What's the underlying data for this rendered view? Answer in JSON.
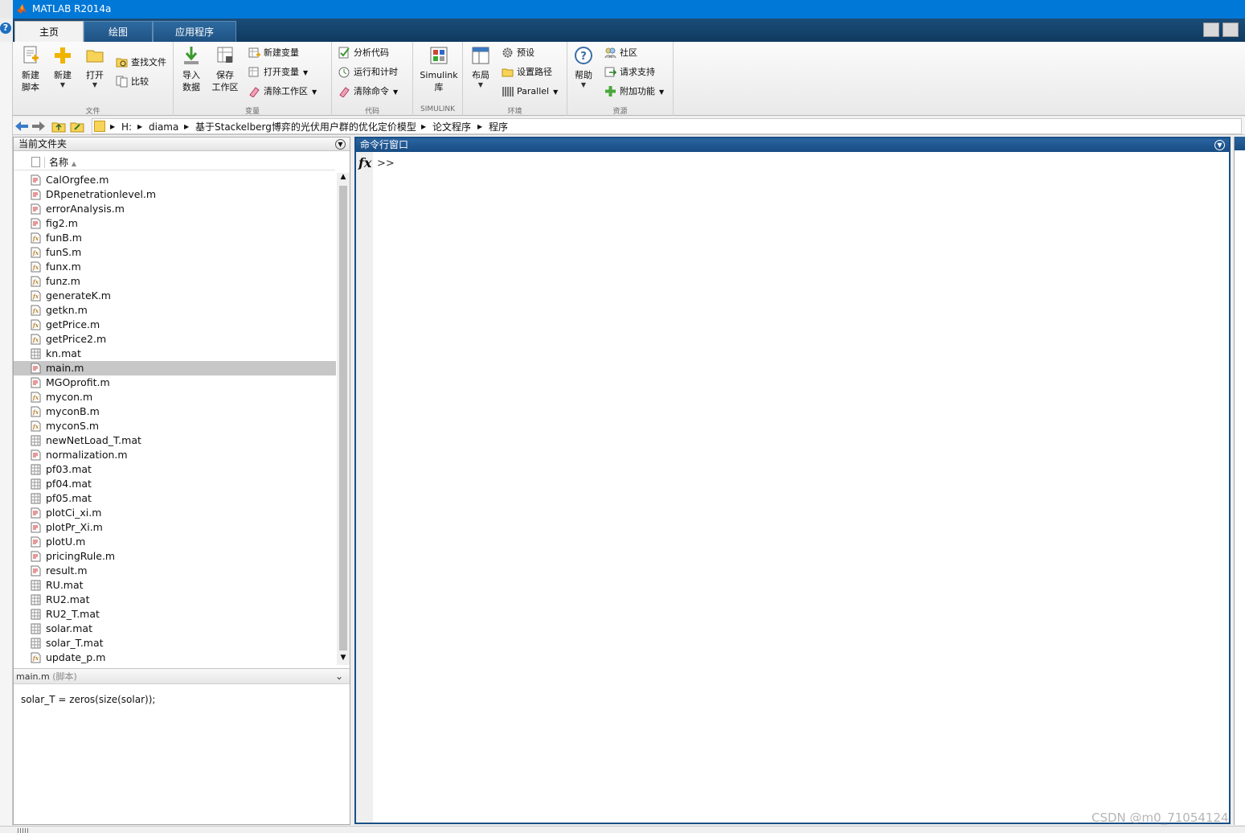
{
  "window": {
    "title": "MATLAB R2014a"
  },
  "tabs": [
    {
      "label": "主页",
      "active": true
    },
    {
      "label": "绘图",
      "active": false
    },
    {
      "label": "应用程序",
      "active": false
    }
  ],
  "ribbon": {
    "file": {
      "section_label": "文件",
      "new_script": "新建\n脚本",
      "new": "新建",
      "open": "打开",
      "find_files": "查找文件",
      "compare": "比较"
    },
    "variable": {
      "section_label": "变量",
      "import_data": "导入\n数据",
      "save_workspace": "保存\n工作区",
      "new_variable": "新建变量",
      "open_variable": "打开变量",
      "clear_workspace": "清除工作区"
    },
    "code": {
      "section_label": "代码",
      "analyze_code": "分析代码",
      "run_and_time": "运行和计时",
      "clear_commands": "清除命令"
    },
    "simulink": {
      "section_label": "SIMULINK",
      "library": "Simulink\n库"
    },
    "environment": {
      "section_label": "环境",
      "layout": "布局",
      "preferences": "预设",
      "set_path": "设置路径",
      "parallel": "Parallel"
    },
    "resources": {
      "section_label": "资源",
      "help": "帮助",
      "community": "社区",
      "request_support": "请求支持",
      "add_ons": "附加功能"
    }
  },
  "address": {
    "crumbs": [
      "H:",
      "diama",
      "基于Stackelberg博弈的光伏用户群的优化定价模型",
      "论文程序",
      "程序"
    ]
  },
  "current_folder": {
    "title": "当前文件夹",
    "column_name": "名称",
    "files": [
      {
        "name": "CalOrgfee.m",
        "type": "script"
      },
      {
        "name": "DRpenetrationlevel.m",
        "type": "script"
      },
      {
        "name": "errorAnalysis.m",
        "type": "script"
      },
      {
        "name": "fig2.m",
        "type": "script"
      },
      {
        "name": "funB.m",
        "type": "function"
      },
      {
        "name": "funS.m",
        "type": "function"
      },
      {
        "name": "funx.m",
        "type": "function"
      },
      {
        "name": "funz.m",
        "type": "function"
      },
      {
        "name": "generateK.m",
        "type": "function"
      },
      {
        "name": "getkn.m",
        "type": "function"
      },
      {
        "name": "getPrice.m",
        "type": "function"
      },
      {
        "name": "getPrice2.m",
        "type": "function"
      },
      {
        "name": "kn.mat",
        "type": "mat"
      },
      {
        "name": "main.m",
        "type": "script",
        "selected": true
      },
      {
        "name": "MGOprofit.m",
        "type": "script"
      },
      {
        "name": "mycon.m",
        "type": "function"
      },
      {
        "name": "myconB.m",
        "type": "function"
      },
      {
        "name": "myconS.m",
        "type": "function"
      },
      {
        "name": "newNetLoad_T.mat",
        "type": "mat"
      },
      {
        "name": "normalization.m",
        "type": "script"
      },
      {
        "name": "pf03.mat",
        "type": "mat"
      },
      {
        "name": "pf04.mat",
        "type": "mat"
      },
      {
        "name": "pf05.mat",
        "type": "mat"
      },
      {
        "name": "plotCi_xi.m",
        "type": "script"
      },
      {
        "name": "plotPr_Xi.m",
        "type": "script"
      },
      {
        "name": "plotU.m",
        "type": "script"
      },
      {
        "name": "pricingRule.m",
        "type": "script"
      },
      {
        "name": "result.m",
        "type": "script"
      },
      {
        "name": "RU.mat",
        "type": "mat"
      },
      {
        "name": "RU2.mat",
        "type": "mat"
      },
      {
        "name": "RU2_T.mat",
        "type": "mat"
      },
      {
        "name": "solar.mat",
        "type": "mat"
      },
      {
        "name": "solar_T.mat",
        "type": "mat"
      },
      {
        "name": "update_p.m",
        "type": "function"
      }
    ],
    "details_file": "main.m",
    "details_kind": "(脚本)",
    "details_content": "solar_T = zeros(size(solar));"
  },
  "command_window": {
    "title": "命令行窗口",
    "fx": "fx",
    "prompt": ">>"
  },
  "watermark": "CSDN @m0_71054124",
  "colors": {
    "titlebar": "#0078d7",
    "tabstrip": "#123f67",
    "command_header": "#1b4f86",
    "selected_row": "#c7c7c7"
  }
}
